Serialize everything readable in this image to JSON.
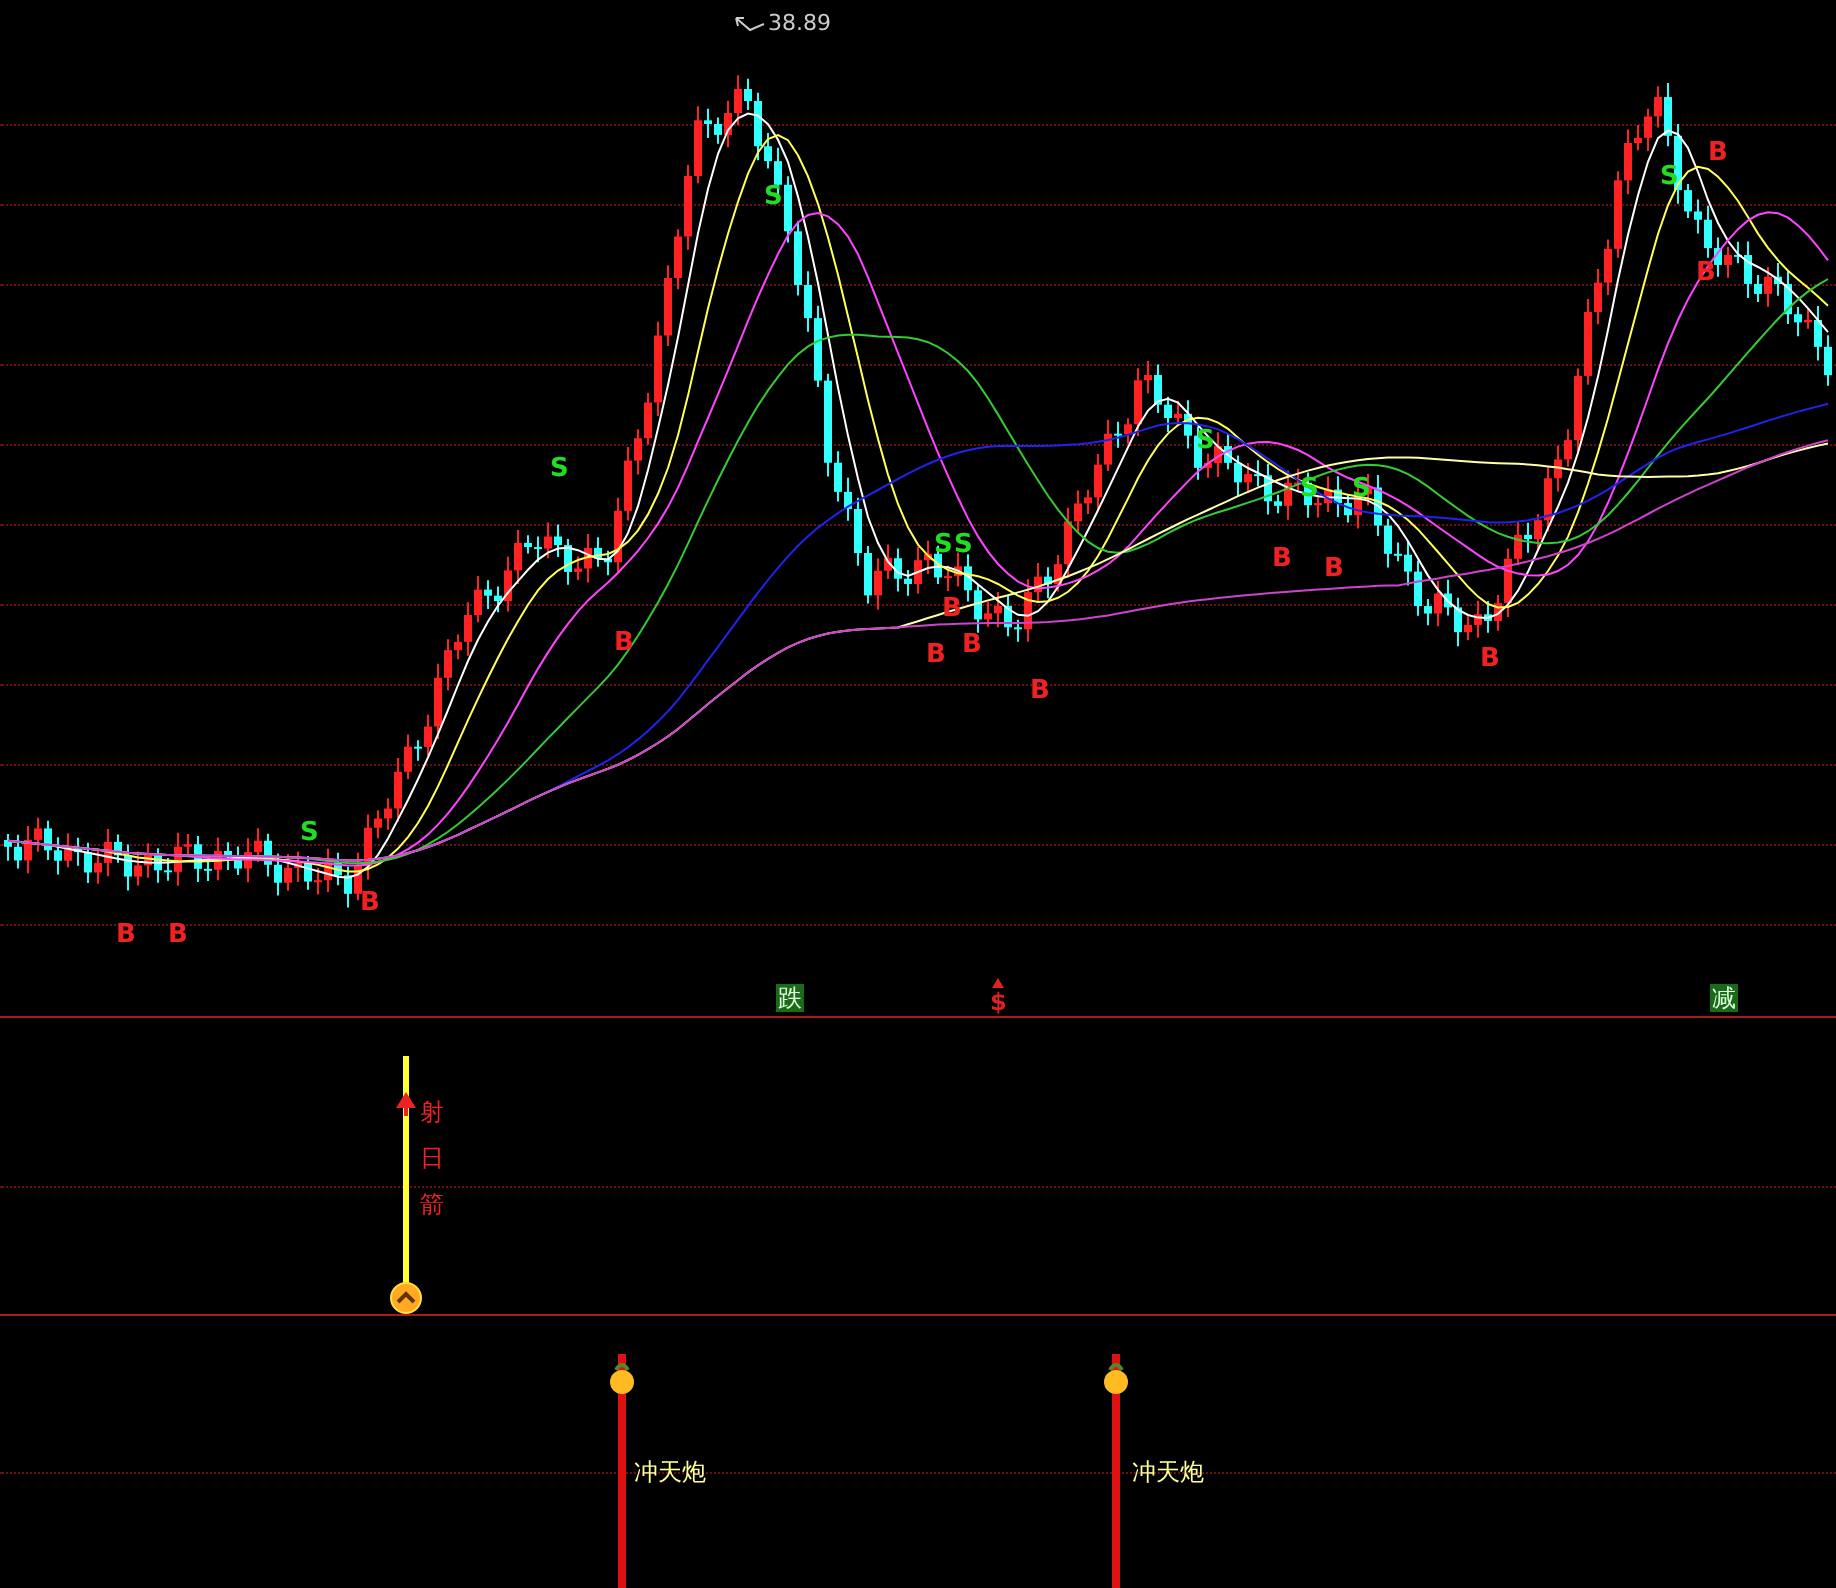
{
  "main_chart": {
    "high_price": "38.89",
    "markers": [
      {
        "kind": "sell",
        "label": "S"
      },
      {
        "kind": "sell",
        "label": "S"
      },
      {
        "kind": "sell",
        "label": "S"
      },
      {
        "kind": "sell",
        "label": "S"
      },
      {
        "kind": "sell",
        "label": "S"
      },
      {
        "kind": "sell",
        "label": "S"
      },
      {
        "kind": "sell",
        "label": "S"
      },
      {
        "kind": "sell",
        "label": "S"
      },
      {
        "kind": "sell",
        "label": "S"
      },
      {
        "kind": "buy",
        "label": "B"
      },
      {
        "kind": "buy",
        "label": "B"
      },
      {
        "kind": "buy",
        "label": "B"
      },
      {
        "kind": "buy",
        "label": "B"
      },
      {
        "kind": "buy",
        "label": "B"
      },
      {
        "kind": "buy",
        "label": "B"
      },
      {
        "kind": "buy",
        "label": "B"
      },
      {
        "kind": "buy",
        "label": "B"
      },
      {
        "kind": "buy",
        "label": "B"
      },
      {
        "kind": "buy",
        "label": "B"
      },
      {
        "kind": "buy",
        "label": "B"
      },
      {
        "kind": "buy",
        "label": "B"
      },
      {
        "kind": "buy",
        "label": "B"
      }
    ],
    "signals": [
      {
        "kind": "boxed",
        "label": "跌"
      },
      {
        "kind": "arrow",
        "label": "$"
      },
      {
        "kind": "boxed",
        "label": "减"
      }
    ]
  },
  "indicator_1": {
    "label": "射日箭"
  },
  "indicator_2": {
    "labels": [
      "冲天炮",
      "冲天炮"
    ]
  }
}
